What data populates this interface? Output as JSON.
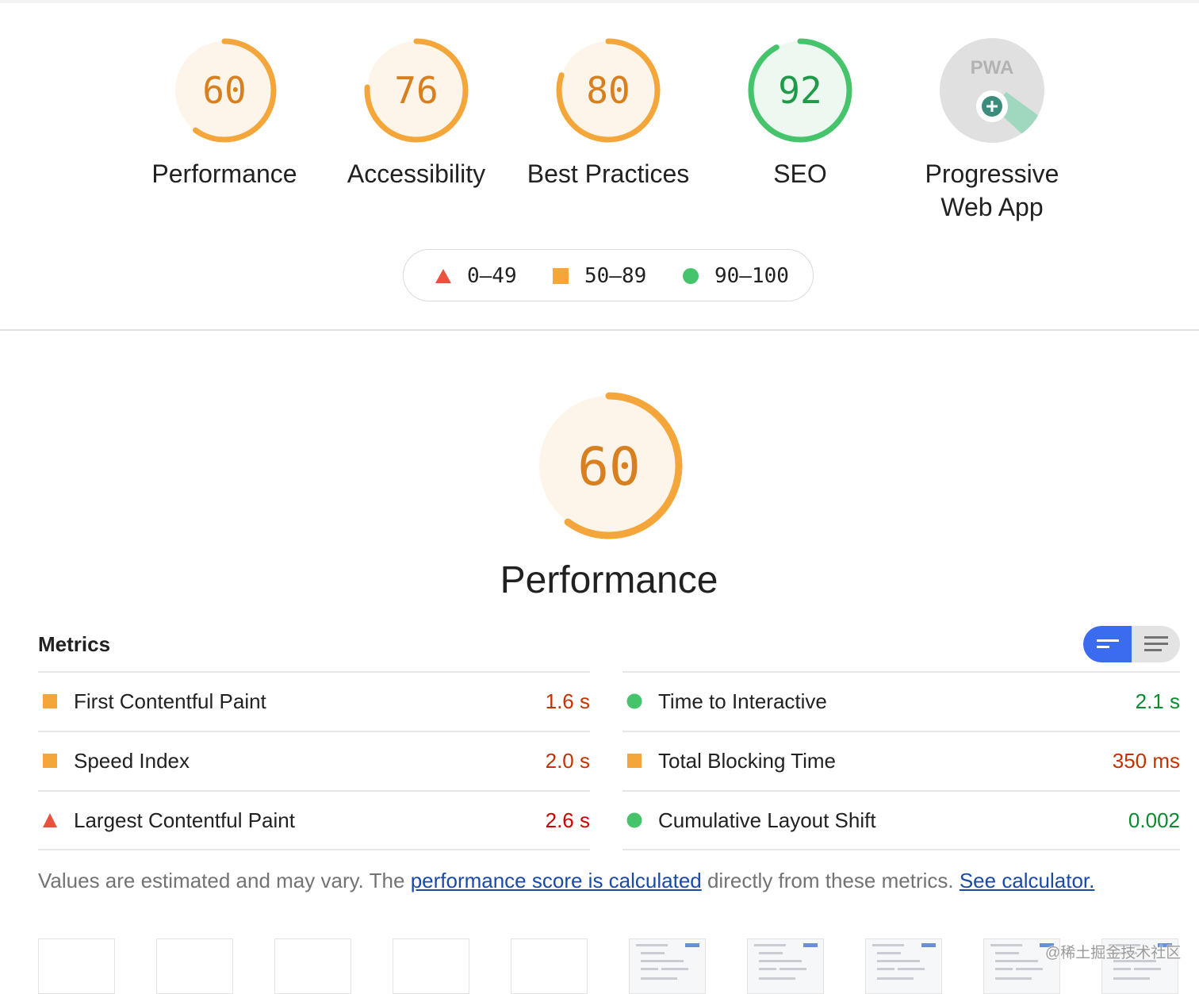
{
  "colors": {
    "average": "#f4a63a",
    "average_bg": "#fdf5ea",
    "pass": "#45c46b",
    "pass_bg": "#edf8f1",
    "fail": "#e8523f",
    "accent_blue": "#3b6cf0",
    "pwa_gray": "#e0e0e0",
    "pwa_green": "#3c8c7e"
  },
  "categories": [
    {
      "label": "Performance",
      "score": "60",
      "rating": "average"
    },
    {
      "label": "Accessibility",
      "score": "76",
      "rating": "average"
    },
    {
      "label": "Best Practices",
      "score": "80",
      "rating": "average"
    },
    {
      "label": "SEO",
      "score": "92",
      "rating": "pass"
    },
    {
      "label": "Progressive\nWeb App",
      "badge_text": "PWA",
      "icon": "pwa-badge-icon"
    }
  ],
  "legend": [
    {
      "range": "0–49",
      "shape": "triangle",
      "color": "#e8523f"
    },
    {
      "range": "50–89",
      "shape": "square",
      "color": "#f4a63a"
    },
    {
      "range": "90–100",
      "shape": "circle",
      "color": "#45c46b"
    }
  ],
  "performance": {
    "title": "Performance",
    "score": "60",
    "rating": "average"
  },
  "metrics": {
    "heading": "Metrics",
    "toggle_icons": [
      "compact-view-icon",
      "expanded-view-icon"
    ],
    "left": [
      {
        "name": "First Contentful Paint",
        "value": "1.6 s",
        "rating": "average"
      },
      {
        "name": "Speed Index",
        "value": "2.0 s",
        "rating": "average"
      },
      {
        "name": "Largest Contentful Paint",
        "value": "2.6 s",
        "rating": "fail"
      }
    ],
    "right": [
      {
        "name": "Time to Interactive",
        "value": "2.1 s",
        "rating": "pass"
      },
      {
        "name": "Total Blocking Time",
        "value": "350 ms",
        "rating": "average"
      },
      {
        "name": "Cumulative Layout Shift",
        "value": "0.002",
        "rating": "pass"
      }
    ]
  },
  "note": {
    "text_before": "Values are estimated and may vary. The ",
    "link1": "performance score is calculated",
    "text_middle": " directly from these metrics. ",
    "link2": "See calculator."
  },
  "watermark": "@稀土掘金技术社区"
}
